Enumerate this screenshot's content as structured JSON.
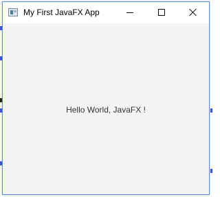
{
  "window": {
    "title": "My First JavaFX App",
    "icon": "java-app-icon",
    "controls": {
      "minimize_icon": "minimize-icon",
      "maximize_icon": "maximize-icon",
      "close_icon": "close-icon"
    }
  },
  "content": {
    "label": "Hello World, JavaFX !"
  },
  "colors": {
    "titlebar": "#ffffff",
    "content_background": "#f4f4f4",
    "window_border": "#5a8fd8",
    "label_text": "#333333"
  }
}
